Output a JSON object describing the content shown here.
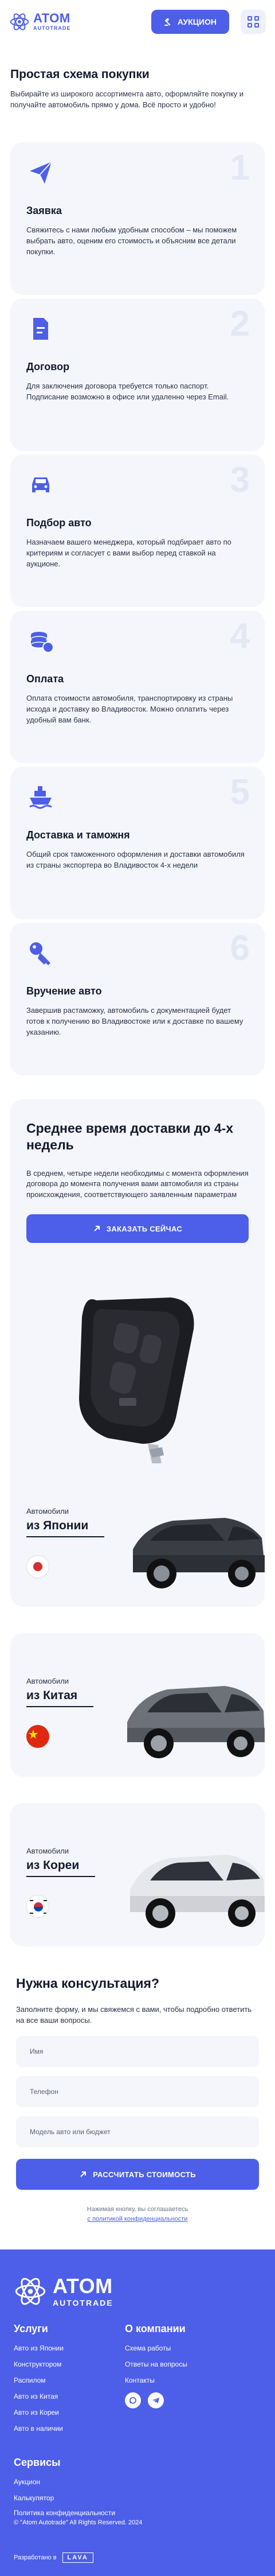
{
  "header": {
    "logo_title": "ATOM",
    "logo_sub": "AUTOTRADE",
    "auction_label": "АУКЦИОН"
  },
  "scheme": {
    "title": "Простая схема покупки",
    "intro": "Выбирайте из широкого ассортимента авто, оформляйте покупку и получайте автомобиль прямо у дома. Всё просто и удобно!",
    "steps": [
      {
        "num": "1",
        "icon": "paper-plane-icon",
        "title": "Заявка",
        "text": "Свяжитесь с нами любым удобным способом – мы поможем выбрать авто, оценим его стоимость и объясним все детали покупки."
      },
      {
        "num": "2",
        "icon": "document-icon",
        "title": "Договор",
        "text": "Для заключения договора требуется только паспорт. Подписание возможно в офисе или удаленно через Email."
      },
      {
        "num": "3",
        "icon": "car-icon",
        "title": "Подбор авто",
        "text": "Назначаем вашего менеджера, который подбирает авто по критериям и согласует с вами выбор перед ставкой на аукционе."
      },
      {
        "num": "4",
        "icon": "coins-icon",
        "title": "Оплата",
        "text": "Оплата стоимости автомобиля, транспортировку из страны исхода и доставку во Владивосток. Можно оплатить через удобный вам банк."
      },
      {
        "num": "5",
        "icon": "ship-icon",
        "title": "Доставка и таможня",
        "text": "Общий срок таможенного оформления и доставки автомобиля из страны экспортера во Владивосток 4-х недели"
      },
      {
        "num": "6",
        "icon": "key-icon",
        "title": "Вручение авто",
        "text": "Завершив растаможку, автомобиль с документацией будет готов к получению во Владивостоке или к доставке по вашему указанию."
      }
    ]
  },
  "delivery": {
    "title": "Среднее время доставки до 4-х недель",
    "text": "В среднем, четыре недели необходимы с момента оформления договора до момента получения вами автомобиля из страны происхождения, соответствующего заявленным параметрам",
    "button": "ЗАКАЗАТЬ СЕЙЧАС"
  },
  "countries": [
    {
      "small": "Автомобили",
      "name": "из Японии",
      "flag": "japan-flag"
    },
    {
      "small": "Автомобили",
      "name": "из Китая",
      "flag": "china-flag"
    },
    {
      "small": "Автомобили",
      "name": "из Кореи",
      "flag": "korea-flag"
    }
  ],
  "consult": {
    "title": "Нужна консультация?",
    "text": "Заполните форму, и мы свяжемся с вами, чтобы подробно ответить на все ваши вопросы.",
    "name_placeholder": "Имя",
    "phone_placeholder": "Телефон",
    "model_placeholder": "Модель авто или бюджет",
    "button": "РАССЧИТАТЬ СТОИМОСТЬ",
    "consent_text": "Нажимая кнопку, вы соглашаетесь",
    "consent_link": "с политикой конфиденциальности"
  },
  "footer": {
    "logo_title": "ATOM",
    "logo_sub": "AUTOTRADE",
    "services_title": "Услуги",
    "services": [
      "Авто из Японии",
      "Конструктором",
      "Распилом",
      "Авто из Китая",
      "Авто из Кореи",
      "Авто в наличии"
    ],
    "company_title": "О компании",
    "company": [
      "Схема работы",
      "Ответы на вопросы",
      "Контакты"
    ],
    "extra_title": "Сервисы",
    "extra": [
      "Аукцион",
      "Калькулятор"
    ],
    "policy": "Политика конфиденциальности",
    "copyright": "© \"Atom Autotrade\" All Rights Reserved. 2024",
    "dev_label": "Разработано в",
    "dev_name": "LAVA"
  },
  "colors": {
    "accent": "#4d5fe8",
    "card_bg": "#f5f6fb",
    "text": "#121a2c"
  }
}
